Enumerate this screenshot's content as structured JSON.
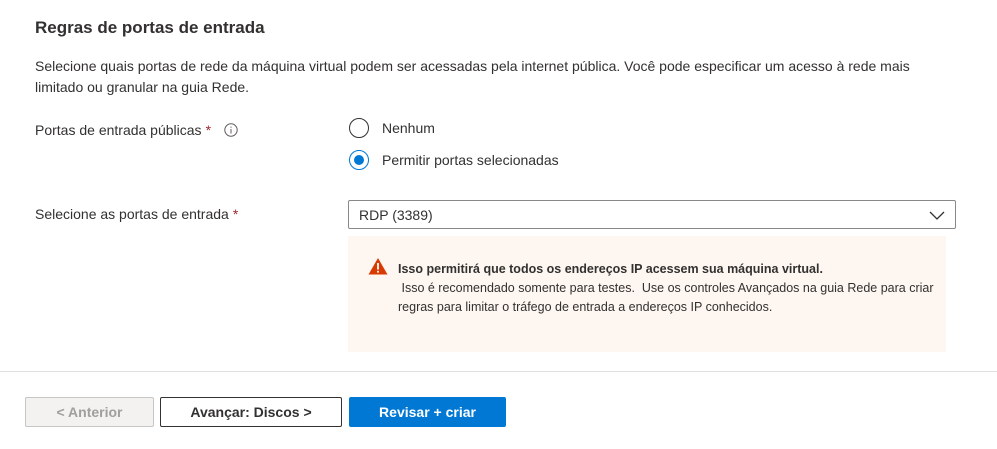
{
  "section": {
    "title": "Regras de portas de entrada",
    "description": "Selecione quais portas de rede da máquina virtual podem ser acessadas pela internet pública. Você pode especificar um acesso à rede mais limitado ou granular na guia Rede."
  },
  "public_ports": {
    "label": "Portas de entrada públicas",
    "required_mark": "*",
    "info_icon": "info-icon",
    "options": [
      {
        "label": "Nenhum",
        "selected": false
      },
      {
        "label": "Permitir portas selecionadas",
        "selected": true
      }
    ]
  },
  "select_ports": {
    "label": "Selecione as portas de entrada",
    "required_mark": "*",
    "value": "RDP (3389)"
  },
  "warning": {
    "icon": "warning-icon",
    "title": "Isso permitirá que todos os endereços IP acessem sua máquina virtual.",
    "body": " Isso é recomendado somente para testes.  Use os controles Avançados na guia Rede para criar regras para limitar o tráfego de entrada a endereços IP conhecidos."
  },
  "footer": {
    "prev_label": "< Anterior",
    "next_label": "Avançar: Discos >",
    "review_label": "Revisar + criar"
  },
  "colors": {
    "accent": "#0078d4",
    "required": "#a4262c",
    "warning_icon": "#d83b01",
    "warning_bg": "#fdf6f1"
  }
}
